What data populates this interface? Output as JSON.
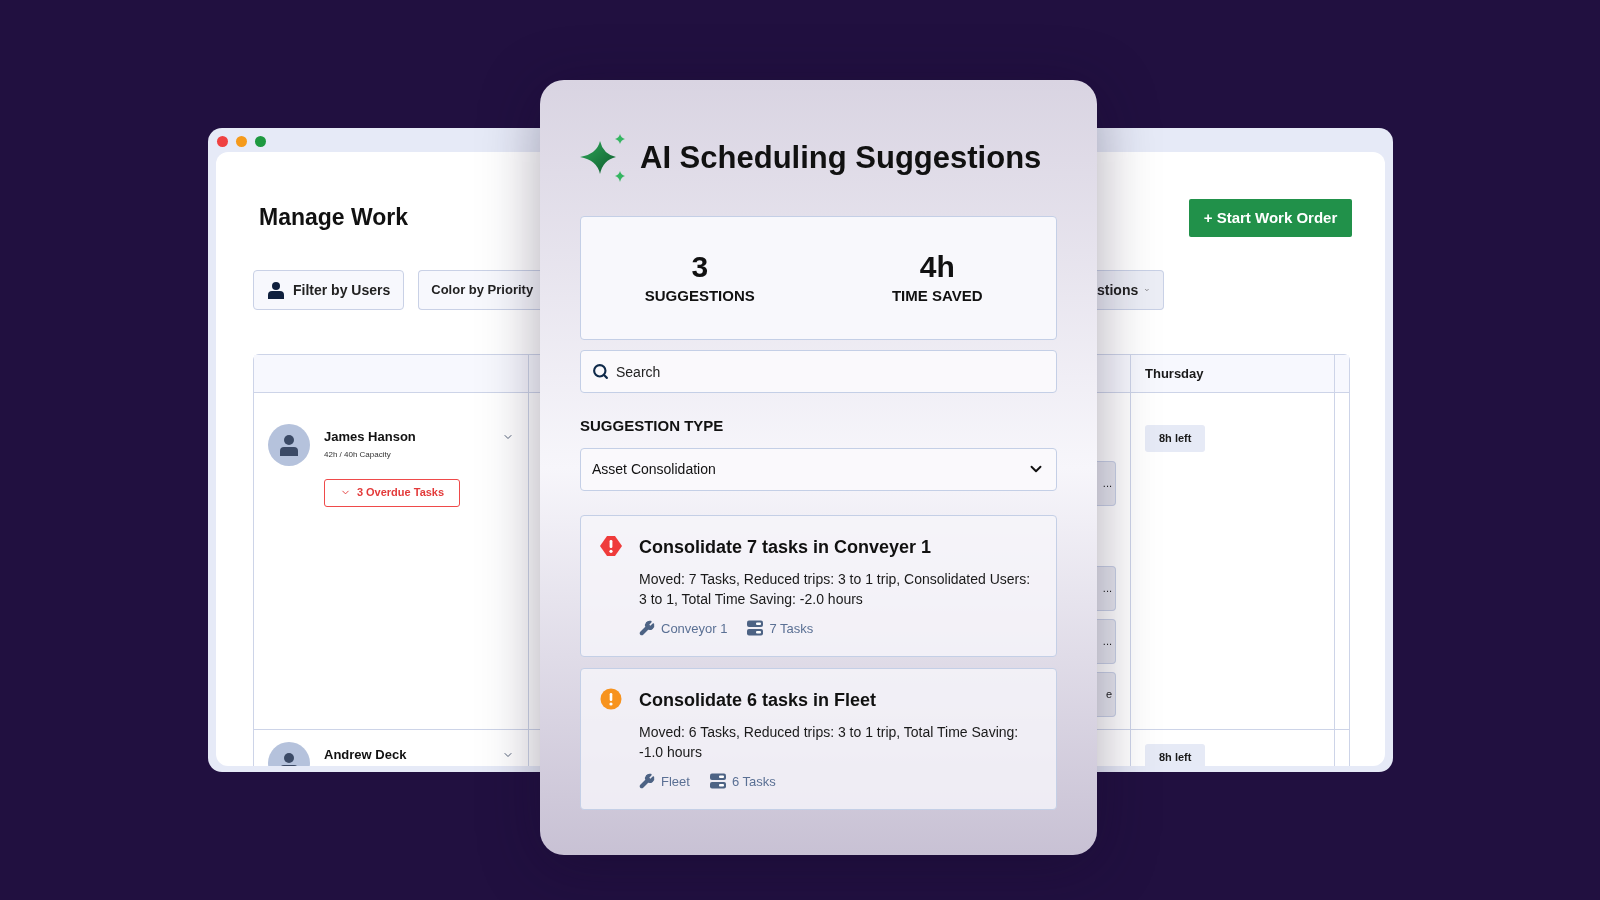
{
  "back_window": {
    "title": "Manage Work",
    "toolbar": [
      {
        "label": "Filter by Users",
        "kind": "user"
      },
      {
        "label": "Color by Priority",
        "kind": "plain"
      }
    ],
    "options_button": {
      "label": "stions"
    },
    "primary_button": {
      "label": "+ Start Work Order"
    },
    "table": {
      "columns": [
        {
          "label": "Thursday"
        }
      ],
      "rows": [
        {
          "name": "James Hanson",
          "capacity": "42h / 40h Capacity",
          "overdue": "3 Overdue Tasks",
          "thursday": "8h left",
          "task_cards": [
            "...",
            "...",
            "...",
            "e"
          ]
        },
        {
          "name": "Andrew Deck",
          "thursday": "8h left"
        }
      ]
    }
  },
  "panel": {
    "title": "AI Scheduling Suggestions",
    "stats": [
      {
        "value": "3",
        "label": "SUGGESTIONS"
      },
      {
        "value": "4h",
        "label": "TIME SAVED"
      }
    ],
    "search": {
      "placeholder": "Search"
    },
    "type_label": "SUGGESTION TYPE",
    "type_select": {
      "value": "Asset Consolidation"
    },
    "suggestions": [
      {
        "kind": "warning",
        "title": "Consolidate 7 tasks in Conveyer 1",
        "description": "Moved: 7 Tasks, Reduced trips: 3 to 1 trip, Consolidated Users: 3 to 1, Total Time Saving: -2.0 hours",
        "asset": "Conveyor 1",
        "tasks": "7 Tasks"
      },
      {
        "kind": "alert",
        "title": "Consolidate 6 tasks in Fleet",
        "description": "Moved: 6 Tasks, Reduced trips: 3 to 1 trip, Total Time Saving: -1.0 hours",
        "asset": "Fleet",
        "tasks": "6 Tasks"
      }
    ]
  }
}
